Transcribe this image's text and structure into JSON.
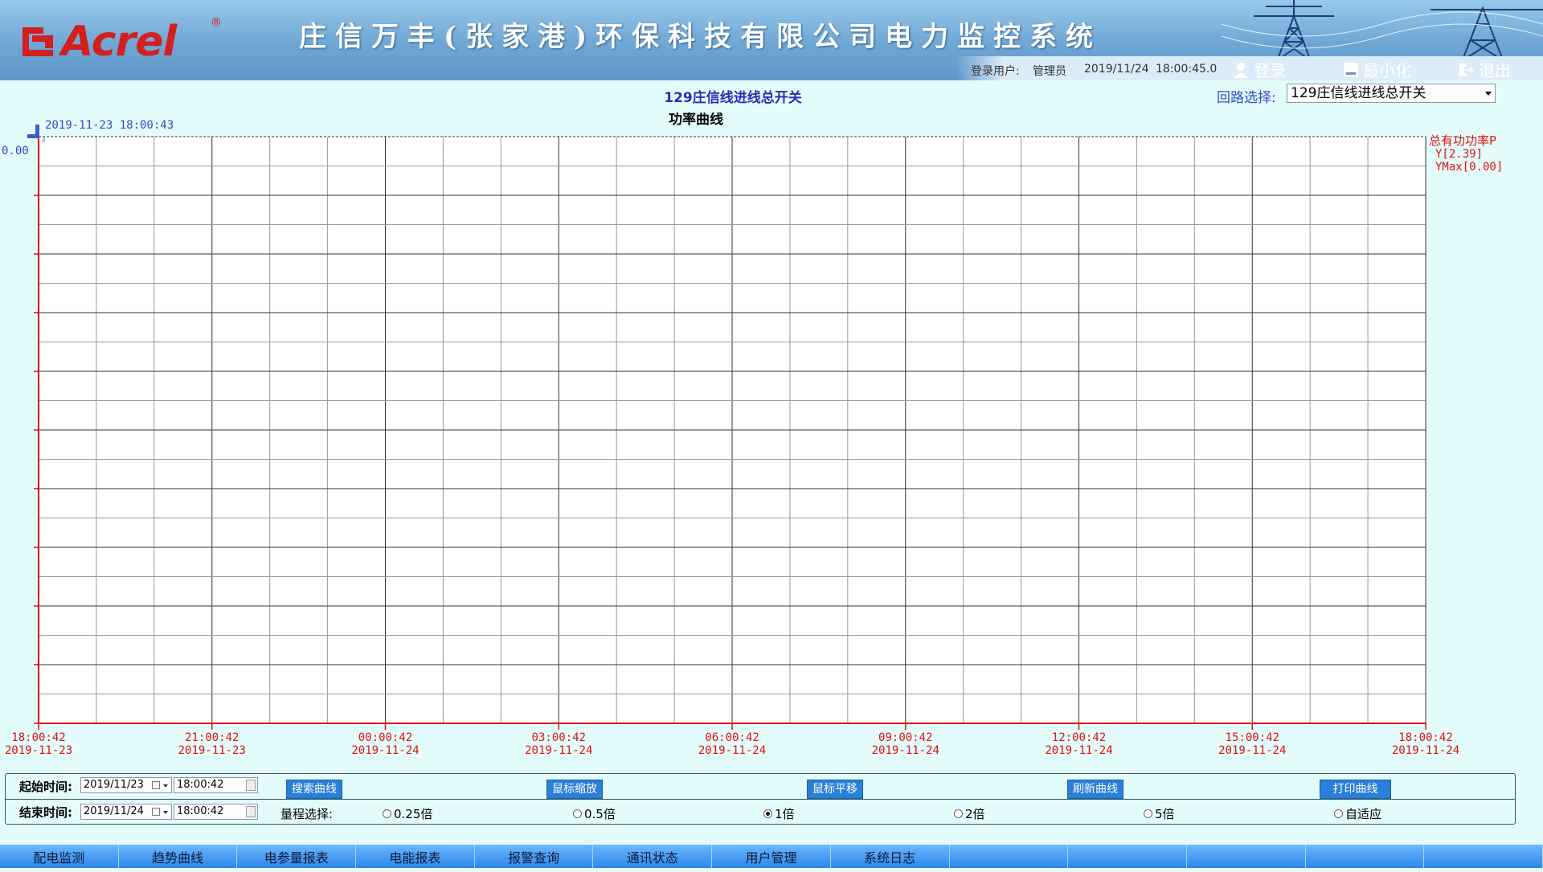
{
  "header": {
    "brand": "Acrel",
    "registered": "®",
    "title": "庄信万丰(张家港)环保科技有限公司电力监控系统",
    "login_label": "登录用户:",
    "user": "管理员",
    "date": "2019/11/24",
    "time": "18:00:45.0",
    "login_btn": "登录",
    "minimize_btn": "最小化",
    "exit_btn": "退出"
  },
  "circuit": {
    "name": "129庄信线进线总开关",
    "select_label": "回路选择:",
    "selected": "129庄信线进线总开关"
  },
  "chart_data": {
    "type": "line",
    "title": "功率曲线",
    "cursor_time": "2019-11-23 18:00:43",
    "y_tick_label": "0.00",
    "legend": {
      "series_name": "总有功功率P",
      "y_value": "Y[2.39]",
      "ymax": "YMax[0.00]"
    },
    "x_ticks": [
      {
        "time": "18:00:42",
        "date": "2019-11-23"
      },
      {
        "time": "21:00:42",
        "date": "2019-11-23"
      },
      {
        "time": "00:00:42",
        "date": "2019-11-24"
      },
      {
        "time": "03:00:42",
        "date": "2019-11-24"
      },
      {
        "time": "06:00:42",
        "date": "2019-11-24"
      },
      {
        "time": "09:00:42",
        "date": "2019-11-24"
      },
      {
        "time": "12:00:42",
        "date": "2019-11-24"
      },
      {
        "time": "15:00:42",
        "date": "2019-11-24"
      },
      {
        "time": "18:00:42",
        "date": "2019-11-24"
      }
    ],
    "series": [],
    "grid": true,
    "colors": {
      "axis": "#e01010",
      "grid": "#555555",
      "text_red": "#e01010",
      "text_blue": "#2a4fc4"
    }
  },
  "controls": {
    "start_label": "起始时间:",
    "start_date": "2019/11/23",
    "start_time": "18:00:42",
    "end_label": "结束时间:",
    "end_date": "2019/11/24",
    "end_time": "18:00:42",
    "range_label": "量程选择:",
    "buttons": [
      "搜索曲线",
      "鼠标缩放",
      "鼠标平移",
      "刷新曲线",
      "打印曲线"
    ],
    "range_options": [
      "0.25倍",
      "0.5倍",
      "1倍",
      "2倍",
      "5倍",
      "自适应"
    ],
    "range_selected": "1倍"
  },
  "nav": [
    "配电监测",
    "趋势曲线",
    "电参量报表",
    "电能报表",
    "报警查询",
    "通讯状态",
    "用户管理",
    "系统日志",
    "",
    "",
    "",
    "",
    ""
  ]
}
